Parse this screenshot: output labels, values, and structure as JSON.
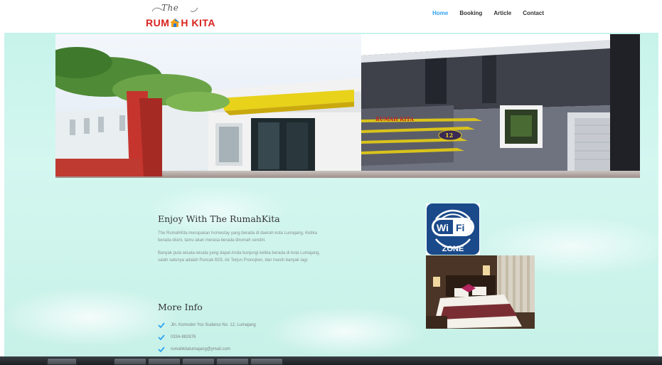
{
  "logo": {
    "script": "The",
    "brand_left": "RUM",
    "brand_right": "H KITA"
  },
  "nav": [
    {
      "label": "Home",
      "active": true
    },
    {
      "label": "Booking",
      "active": false
    },
    {
      "label": "Article",
      "active": false
    },
    {
      "label": "Contact",
      "active": false
    }
  ],
  "hero": {
    "sign_number": "12"
  },
  "intro": {
    "title": "Enjoy With The RumahKita",
    "paragraph1": "The RumahKita merupakan homestay yang berada di daerah kota Lumajang. Ketika berada disini, tamu akan merasa berada dirumah sendiri.",
    "paragraph2": "Banyak pula wisata-wisata yang dapat Anda kunjungi ketika berada di kota Lumajang, salah satunya adalah Puncak B29, Air Terjun Pronojiwo, dan masih banyak lagi."
  },
  "more_info": {
    "title": "More Info",
    "items": [
      "Jln. Komodor Yos Sudarso No. 12, Lumajang",
      "0334-882876",
      "rumahkitalumajang@ymail.com"
    ]
  },
  "wifi": {
    "top": "Wi",
    "bottom": "Fi",
    "zone": "ZONE"
  },
  "colors": {
    "accent": "#2ea3f2",
    "brand_red": "#d8231f",
    "wifi_blue": "#1b4a8a"
  }
}
